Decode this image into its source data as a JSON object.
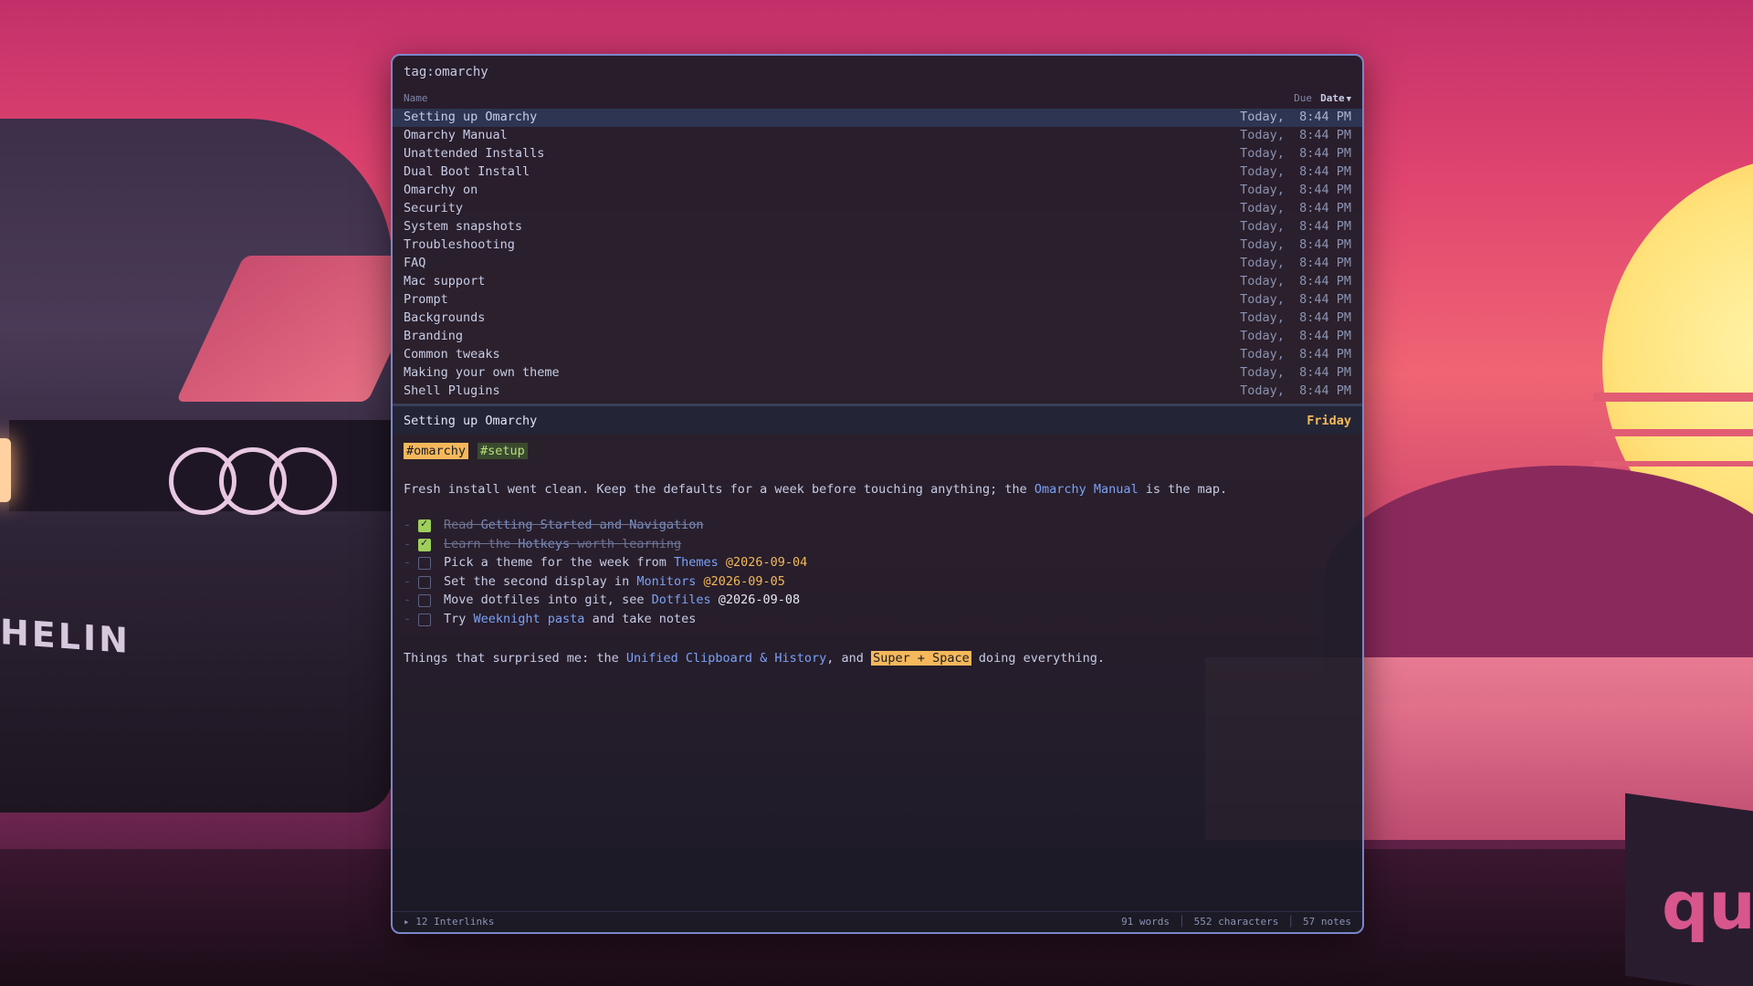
{
  "window": {
    "search_query": "tag:omarchy",
    "columns": {
      "name": "Name",
      "due": "Due",
      "date": "Date"
    },
    "notes": [
      {
        "name": "Setting up Omarchy",
        "date": "Today,  8:44 PM"
      },
      {
        "name": "Omarchy Manual",
        "date": "Today,  8:44 PM"
      },
      {
        "name": "Unattended Installs",
        "date": "Today,  8:44 PM"
      },
      {
        "name": "Dual Boot Install",
        "date": "Today,  8:44 PM"
      },
      {
        "name": "Omarchy on",
        "date": "Today,  8:44 PM"
      },
      {
        "name": "Security",
        "date": "Today,  8:44 PM"
      },
      {
        "name": "System snapshots",
        "date": "Today,  8:44 PM"
      },
      {
        "name": "Troubleshooting",
        "date": "Today,  8:44 PM"
      },
      {
        "name": "FAQ",
        "date": "Today,  8:44 PM"
      },
      {
        "name": "Mac support",
        "date": "Today,  8:44 PM"
      },
      {
        "name": "Prompt",
        "date": "Today,  8:44 PM"
      },
      {
        "name": "Backgrounds",
        "date": "Today,  8:44 PM"
      },
      {
        "name": "Branding",
        "date": "Today,  8:44 PM"
      },
      {
        "name": "Common tweaks",
        "date": "Today,  8:44 PM"
      },
      {
        "name": "Making your own theme",
        "date": "Today,  8:44 PM"
      },
      {
        "name": "Shell Plugins",
        "date": "Today,  8:44 PM"
      }
    ],
    "selected_index": 0
  },
  "preview": {
    "title": "Setting up Omarchy",
    "day": "Friday",
    "tag_omarchy_hash": "#",
    "tag_omarchy": "omarchy",
    "tag_setup": "#setup",
    "intro": {
      "before": "Fresh install went clean. Keep the defaults for a week before touching anything; the ",
      "link": "Omarchy Manual",
      "after": " is the map."
    },
    "tasks": {
      "t1": {
        "a": "Read ",
        "link": "Getting Started and Navigation",
        "done": true
      },
      "t2": {
        "a": "Learn the ",
        "link": "Hotkeys",
        "b": " worth learning",
        "done": true
      },
      "t3": {
        "a": "Pick a theme for the week from ",
        "link": "Themes",
        "date": "@2026-09-04",
        "done": false
      },
      "t4": {
        "a": "Set the second display in ",
        "link": "Monitors",
        "date": "@2026-09-05",
        "done": false
      },
      "t5": {
        "a": "Move dotfiles into git, see ",
        "link": "Dotfiles",
        "date": "@2026-09-08",
        "done": false
      },
      "t6": {
        "a": "Try ",
        "link": "Weeknight pasta",
        "b": " and take notes",
        "done": false
      }
    },
    "dash": "-",
    "outro": {
      "before": "Things that surprised me: the ",
      "link": "Unified Clipboard & History",
      "mid": ", and ",
      "highlight": "Super + Space",
      "after": " doing everything."
    }
  },
  "status": {
    "interlinks": "12 Interlinks",
    "words": "91 words",
    "characters": "552 characters",
    "notes": "57 notes"
  },
  "wallpaper": {
    "car_badge": "HELIN",
    "sign_text": "qu"
  },
  "colors": {
    "accent": "#7a86c9",
    "tag": "#f5b85a",
    "link": "#7aa2f7",
    "done_check": "#9ecf5a"
  },
  "icons": {
    "sort": "sort-desc-icon",
    "bullet": "bullet-icon"
  }
}
